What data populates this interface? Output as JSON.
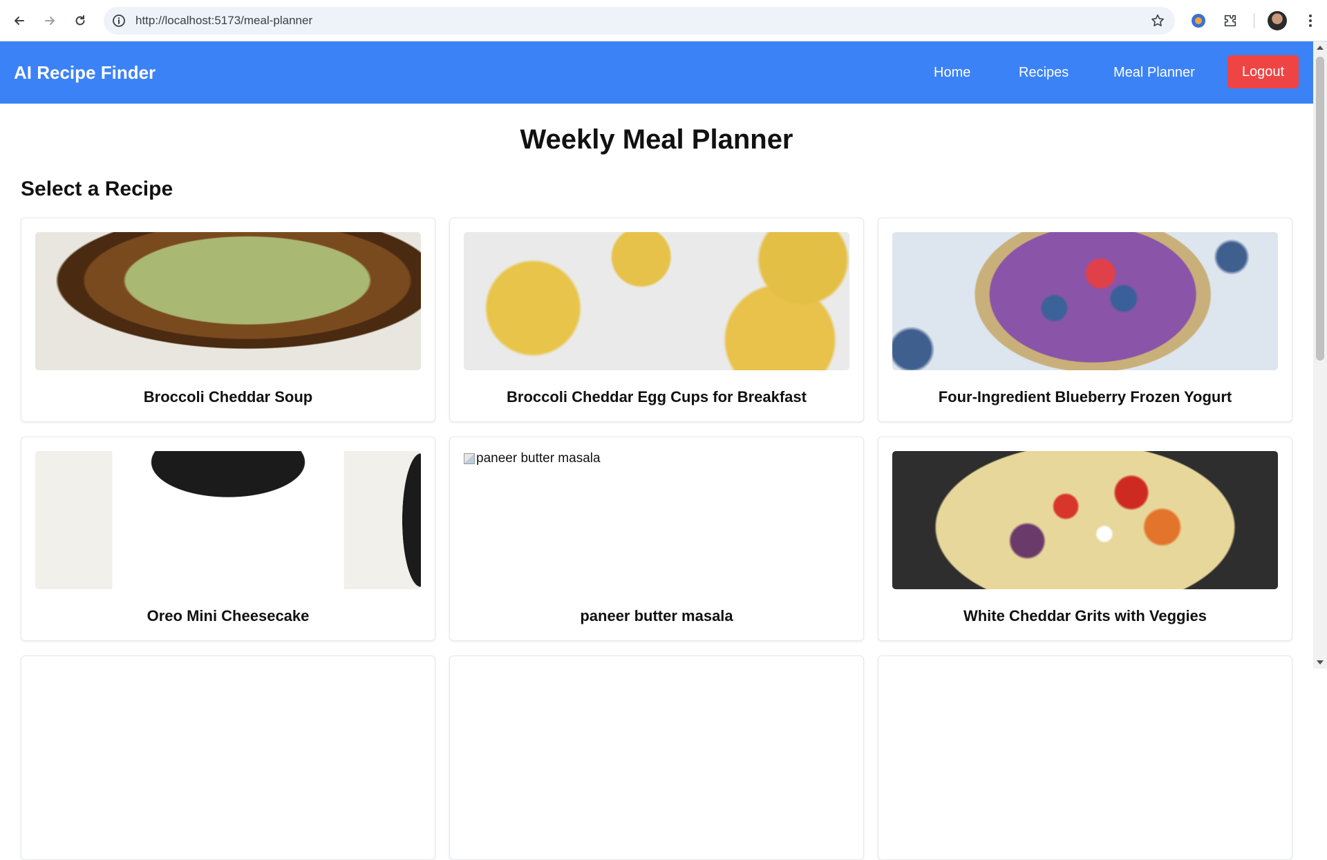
{
  "browser": {
    "url": "http://localhost:5173/meal-planner"
  },
  "header": {
    "brand": "AI Recipe Finder",
    "nav": [
      {
        "label": "Home"
      },
      {
        "label": "Recipes"
      },
      {
        "label": "Meal Planner"
      }
    ],
    "logout_label": "Logout"
  },
  "main": {
    "title": "Weekly Meal Planner",
    "section_title": "Select a Recipe",
    "recipes": [
      {
        "title": "Broccoli Cheddar Soup",
        "image": "soup-photo"
      },
      {
        "title": "Broccoli Cheddar Egg Cups for Breakfast",
        "image": "egg-cups-photo"
      },
      {
        "title": "Four-Ingredient Blueberry Frozen Yogurt",
        "image": "frozen-yogurt-photo"
      },
      {
        "title": "Oreo Mini Cheesecake",
        "image": "cheesecake-photo"
      },
      {
        "title": "paneer butter masala",
        "image": "broken",
        "alt": "paneer butter masala"
      },
      {
        "title": "White Cheddar Grits with Veggies",
        "image": "grits-photo"
      }
    ]
  },
  "colors": {
    "header_bg": "#3b82f6",
    "logout_bg": "#ef4444"
  }
}
